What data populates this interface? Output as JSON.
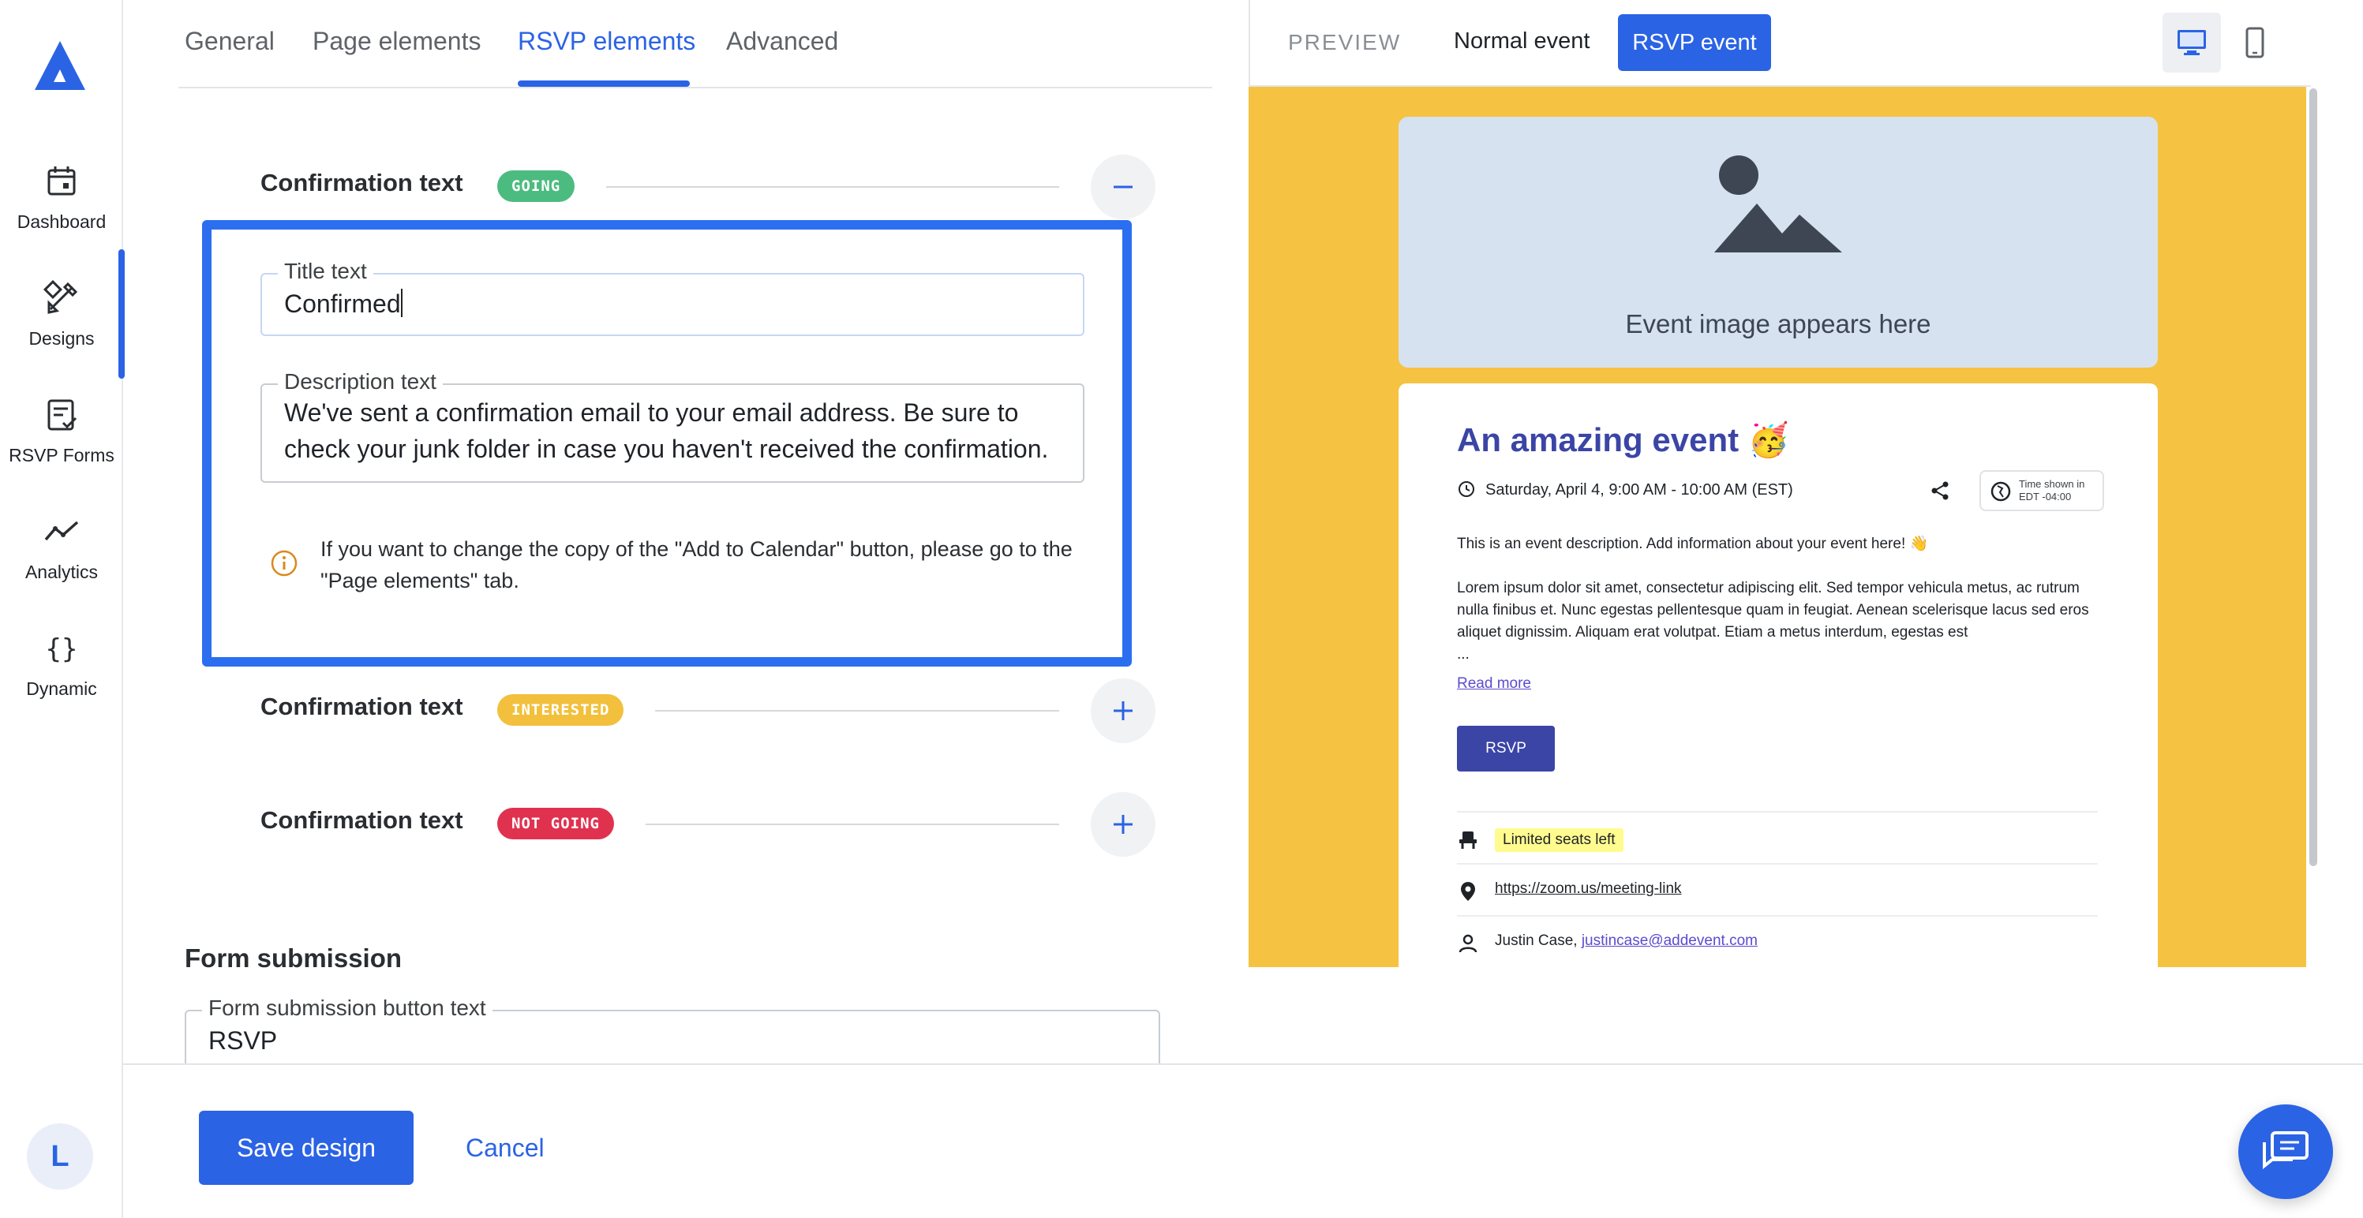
{
  "sidebar": {
    "items": [
      {
        "label": "Dashboard",
        "icon": "calendar-icon"
      },
      {
        "label": "Designs",
        "icon": "design-tools-icon"
      },
      {
        "label": "RSVP Forms",
        "icon": "form-check-icon"
      },
      {
        "label": "Analytics",
        "icon": "analytics-line-icon"
      },
      {
        "label": "Dynamic",
        "icon": "curly-braces-icon"
      }
    ],
    "active_item": "Designs",
    "avatar_initial": "L"
  },
  "tabs": [
    {
      "label": "General"
    },
    {
      "label": "Page elements"
    },
    {
      "label": "RSVP elements",
      "active": true
    },
    {
      "label": "Advanced"
    }
  ],
  "confirmations": [
    {
      "title": "Confirmation text",
      "badge": "GOING",
      "badge_color": "#4cbb7f",
      "expanded": true
    },
    {
      "title": "Confirmation text",
      "badge": "INTERESTED",
      "badge_color": "#f2c03c",
      "expanded": false
    },
    {
      "title": "Confirmation text",
      "badge": "NOT GOING",
      "badge_color": "#e0324f",
      "expanded": false
    }
  ],
  "going_panel": {
    "title_label": "Title text",
    "title_value": "Confirmed",
    "description_label": "Description text",
    "description_value": "We've sent a confirmation email to your email address. Be sure to check your junk folder in case you haven't received the confirmation.",
    "info_text": "If you want to change the copy of the \"Add to Calendar\" button, please go to the \"Page elements\" tab."
  },
  "form_submission": {
    "section_title": "Form submission",
    "button_text_label": "Form submission button text",
    "button_text_value": "RSVP"
  },
  "footer": {
    "save_label": "Save design",
    "cancel_label": "Cancel"
  },
  "preview": {
    "label": "PREVIEW",
    "normal_event": "Normal event",
    "rsvp_event": "RSVP event",
    "selected_event": "RSVP event",
    "devices": [
      {
        "name": "desktop-icon",
        "active": true
      },
      {
        "name": "mobile-icon",
        "active": false
      }
    ],
    "canvas_color": "#f5c242",
    "image_caption": "Event image appears here",
    "event_title": "An amazing event 🥳",
    "event_date": "Saturday, April 4, 9:00 AM - 10:00 AM (EST)",
    "timezone_line1": "Time shown in",
    "timezone_line2": "EDT -04:00",
    "description_intro": "This is an event description. Add information about your event here! 👋",
    "description_body": "Lorem ipsum dolor sit amet, consectetur adipiscing elit. Sed tempor vehicula metus, ac rutrum nulla finibus et. Nunc egestas pellentesque quam in feugiat. Aenean scelerisque lacus sed eros aliquet dignissim. Aliquam erat volutpat. Etiam a metus interdum, egestas est",
    "ellipsis": "...",
    "read_more": "Read more",
    "rsvp_button": "RSVP",
    "seats_badge": "Limited seats left",
    "location_link": "https://zoom.us/meeting-link",
    "organizer_name": "Justin Case,",
    "organizer_email": "justincase@addevent.com"
  }
}
